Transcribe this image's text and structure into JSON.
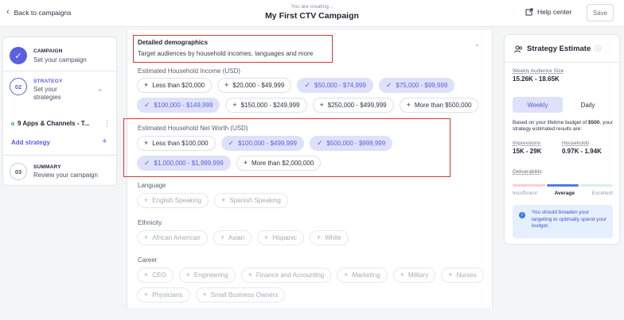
{
  "header": {
    "back_label": "Back to campaigns",
    "subtitle": "You are creating...",
    "title": "My First CTV Campaign",
    "help_label": "Help center",
    "save_label": "Save"
  },
  "steps": {
    "campaign": {
      "number": "✓",
      "title": "CAMPAIGN",
      "desc": "Set your campaign"
    },
    "strategy": {
      "number": "02",
      "title": "STRATEGY",
      "desc_line1": "Set your",
      "desc_line2": "strategies"
    },
    "strategy_item": "9 Apps & Channels - T...",
    "add_strategy": "Add strategy",
    "summary": {
      "number": "03",
      "title": "SUMMARY",
      "desc": "Review your campaign"
    }
  },
  "section": {
    "title": "Detailed demographics",
    "subtitle": "Target audiences by household incomes, languages and more"
  },
  "income": {
    "label": "Estimated Household Income (USD)",
    "rows": [
      [
        {
          "text": "Less than $20,000",
          "selected": false
        },
        {
          "text": "$20,000 - $49,999",
          "selected": false
        },
        {
          "text": "$50,000 - $74,999",
          "selected": true
        },
        {
          "text": "$75,000 - $99,999",
          "selected": true
        }
      ],
      [
        {
          "text": "$100,000 - $149,999",
          "selected": true
        },
        {
          "text": "$150,000 - $249,999",
          "selected": false
        },
        {
          "text": "$250,000 - $499,999",
          "selected": false
        },
        {
          "text": "More than $500,000",
          "selected": false
        }
      ]
    ]
  },
  "net_worth": {
    "label": "Estimated Household Net Worth (USD)",
    "rows": [
      [
        {
          "text": "Less than $100,000",
          "selected": false
        },
        {
          "text": "$100,000 - $499,999",
          "selected": true
        },
        {
          "text": "$500,000 - $999,999",
          "selected": true
        }
      ],
      [
        {
          "text": "$1,000,000 - $1,999,999",
          "selected": true
        },
        {
          "text": "More than $2,000,000",
          "selected": false
        }
      ]
    ]
  },
  "language": {
    "label": "Language",
    "rows": [
      [
        {
          "text": "English Speaking"
        },
        {
          "text": "Spanish Speaking"
        }
      ]
    ]
  },
  "ethnicity": {
    "label": "Ethnicity",
    "rows": [
      [
        {
          "text": "African American"
        },
        {
          "text": "Asian"
        },
        {
          "text": "Hispanic"
        },
        {
          "text": "White"
        }
      ]
    ]
  },
  "career": {
    "label": "Career",
    "rows": [
      [
        {
          "text": "CEO"
        },
        {
          "text": "Engineering"
        },
        {
          "text": "Finance and Accounting"
        },
        {
          "text": "Marketing"
        },
        {
          "text": "Military"
        },
        {
          "text": "Nurses"
        }
      ],
      [
        {
          "text": "Physicians"
        },
        {
          "text": "Small Business Owners"
        }
      ]
    ]
  },
  "estimate": {
    "title": "Strategy Estimate",
    "weekly_audience_label": "Weekly Audience Size",
    "weekly_audience_value": "15.26K - 18.65K",
    "toggle_weekly": "Weekly",
    "toggle_daily": "Daily",
    "budget_note_pre": "Based on your lifetime budget of ",
    "budget_amount": "$500",
    "budget_note_post": ", your strategy estimated results are:",
    "impressions_label": "Impressions",
    "impressions_value": "15K - 29K",
    "households_label": "Households",
    "households_value": "0.97K - 1.94K",
    "deliverability_label": "Deliverability",
    "levels": [
      "Insufficient",
      "Average",
      "Excellent"
    ],
    "advice": "You should broaden your targeting to optimally spend your budget.",
    "colors": {
      "insufficient": "#f6d2d2",
      "average": "#4f7be6",
      "excellent": "#d8f0e2"
    }
  }
}
